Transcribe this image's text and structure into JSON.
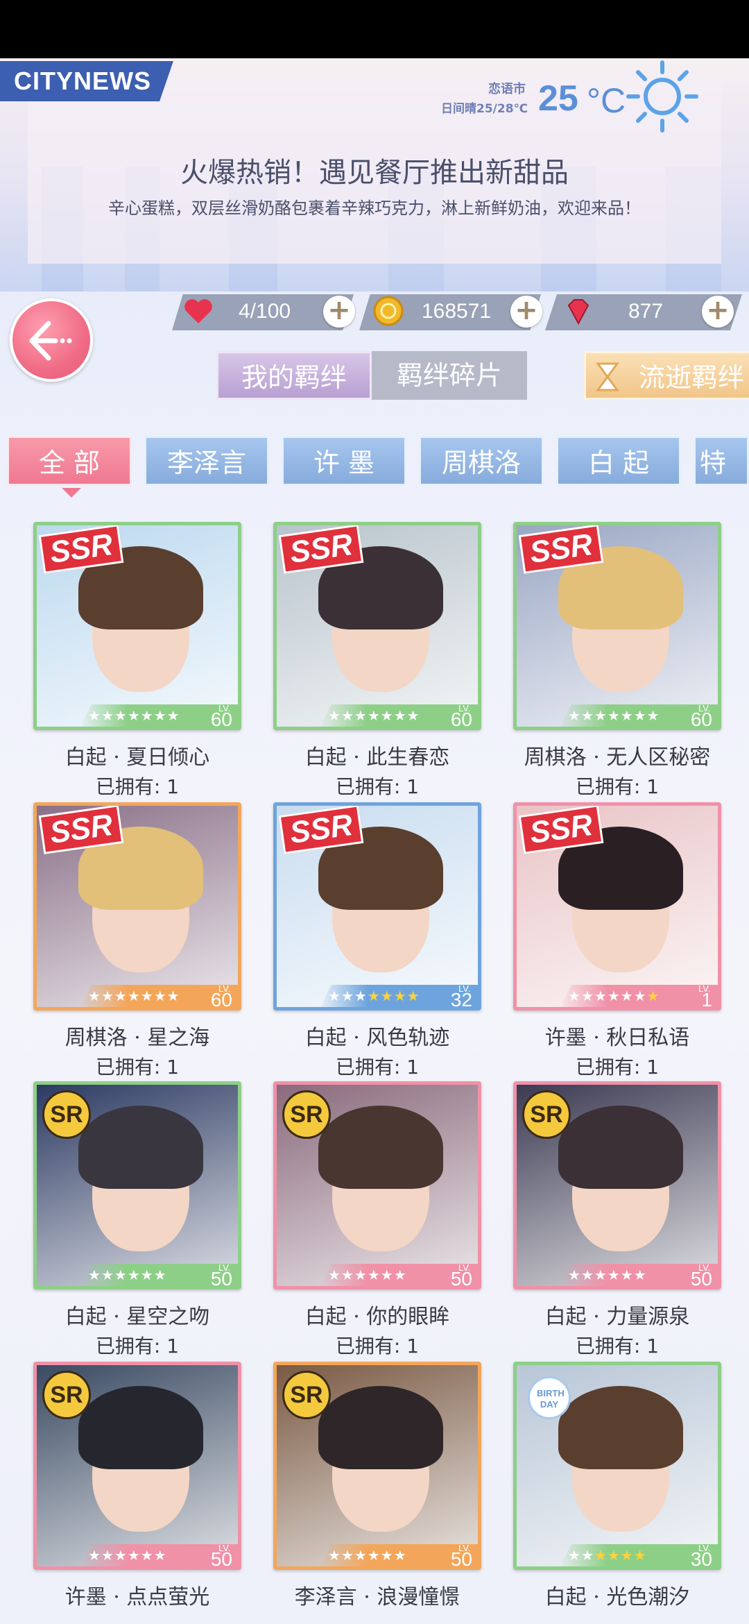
{
  "news": {
    "logo": "CITYNEWS",
    "city": "恋语市",
    "weather": "日间晴25/28℃",
    "temp": "25",
    "unit": "°C",
    "headline": "火爆热销！遇见餐厅推出新甜品",
    "subline": "辛心蛋糕，双层丝滑奶酪包裹着辛辣巧克力，淋上新鲜奶油，欢迎来品！"
  },
  "resources": {
    "stamina": "4/100",
    "coins": "168571",
    "diamonds": "877"
  },
  "main_tabs": [
    "我的羁绊",
    "羁绊碎片",
    "流逝羁绊"
  ],
  "filter_tabs": [
    "全 部",
    "李泽言",
    "许 墨",
    "周棋洛",
    "白 起",
    "特别"
  ],
  "owned_prefix": "已拥有: ",
  "cards": [
    {
      "name": "白起 · 夏日倾心",
      "rarity": "SSR",
      "level": "60",
      "stars": 7,
      "stars_on": 0,
      "owned": "1",
      "color": "#8dcf87"
    },
    {
      "name": "白起 · 此生春恋",
      "rarity": "SSR",
      "level": "60",
      "stars": 7,
      "stars_on": 0,
      "owned": "1",
      "color": "#8dcf87"
    },
    {
      "name": "周棋洛 · 无人区秘密",
      "rarity": "SSR",
      "level": "60",
      "stars": 7,
      "stars_on": 0,
      "owned": "1",
      "color": "#8dcf87"
    },
    {
      "name": "周棋洛 · 星之海",
      "rarity": "SSR",
      "level": "60",
      "stars": 7,
      "stars_on": 0,
      "owned": "1",
      "color": "#f3a65a"
    },
    {
      "name": "白起 · 风色轨迹",
      "rarity": "SSR",
      "level": "32",
      "stars": 7,
      "stars_on": 4,
      "owned": "1",
      "color": "#6ea4dd"
    },
    {
      "name": "许墨 · 秋日私语",
      "rarity": "SSR",
      "level": "1",
      "stars": 7,
      "stars_on": 1,
      "owned": "1",
      "color": "#f091a8"
    },
    {
      "name": "白起 · 星空之吻",
      "rarity": "SR",
      "level": "50",
      "stars": 6,
      "stars_on": 0,
      "owned": "1",
      "color": "#8dcf87"
    },
    {
      "name": "白起 · 你的眼眸",
      "rarity": "SR",
      "level": "50",
      "stars": 6,
      "stars_on": 0,
      "owned": "1",
      "color": "#f091a8"
    },
    {
      "name": "白起 · 力量源泉",
      "rarity": "SR",
      "level": "50",
      "stars": 6,
      "stars_on": 0,
      "owned": "1",
      "color": "#f091a8"
    },
    {
      "name": "许墨 · 点点萤光",
      "rarity": "SR",
      "level": "50",
      "stars": 6,
      "stars_on": 0,
      "owned": "",
      "color": "#f091a8"
    },
    {
      "name": "李泽言 · 浪漫憧憬",
      "rarity": "SR",
      "level": "50",
      "stars": 6,
      "stars_on": 0,
      "owned": "",
      "color": "#f3a65a"
    },
    {
      "name": "白起 · 光色潮汐",
      "rarity": "BIRTH DAY",
      "level": "30",
      "stars": 6,
      "stars_on": 4,
      "owned": "",
      "color": "#8dcf87"
    }
  ]
}
